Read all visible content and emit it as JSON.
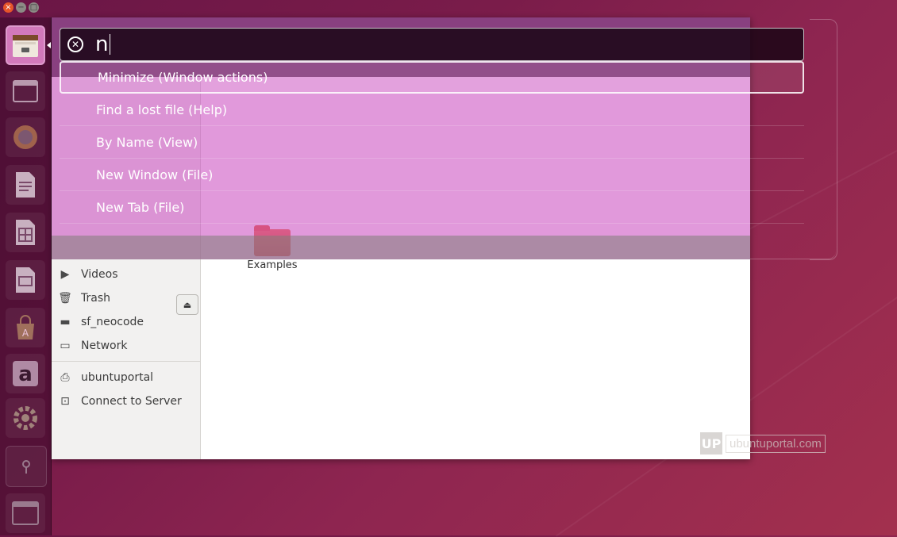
{
  "window_controls": {
    "close": "×",
    "minimize": "−",
    "maximize": "□"
  },
  "launcher": {
    "items": [
      {
        "name": "files-icon"
      },
      {
        "name": "window-icon"
      },
      {
        "name": "firefox-icon"
      },
      {
        "name": "writer-icon"
      },
      {
        "name": "calc-icon"
      },
      {
        "name": "impress-icon"
      },
      {
        "name": "software-center-icon"
      },
      {
        "name": "amazon-icon"
      },
      {
        "name": "settings-icon"
      },
      {
        "name": "usb-icon"
      },
      {
        "name": "workspace-icon"
      }
    ]
  },
  "hud": {
    "query": "n",
    "results": [
      {
        "label": "Minimize (Window actions)",
        "selected": true
      },
      {
        "label": "Find a lost file (Help)",
        "selected": false
      },
      {
        "label": "By Name (View)",
        "selected": false
      },
      {
        "label": "New Window (File)",
        "selected": false
      },
      {
        "label": "New Tab (File)",
        "selected": false
      }
    ]
  },
  "file_manager": {
    "sidebar": {
      "videos": "Videos",
      "trash": "Trash",
      "sf_neocode": "sf_neocode",
      "network": "Network",
      "ubuntuportal": "ubuntuportal",
      "connect_server": "Connect to Server"
    },
    "folders": {
      "examples": "Examples"
    }
  },
  "watermark": {
    "logo": "UP",
    "text": "ubuntuportal.com"
  }
}
